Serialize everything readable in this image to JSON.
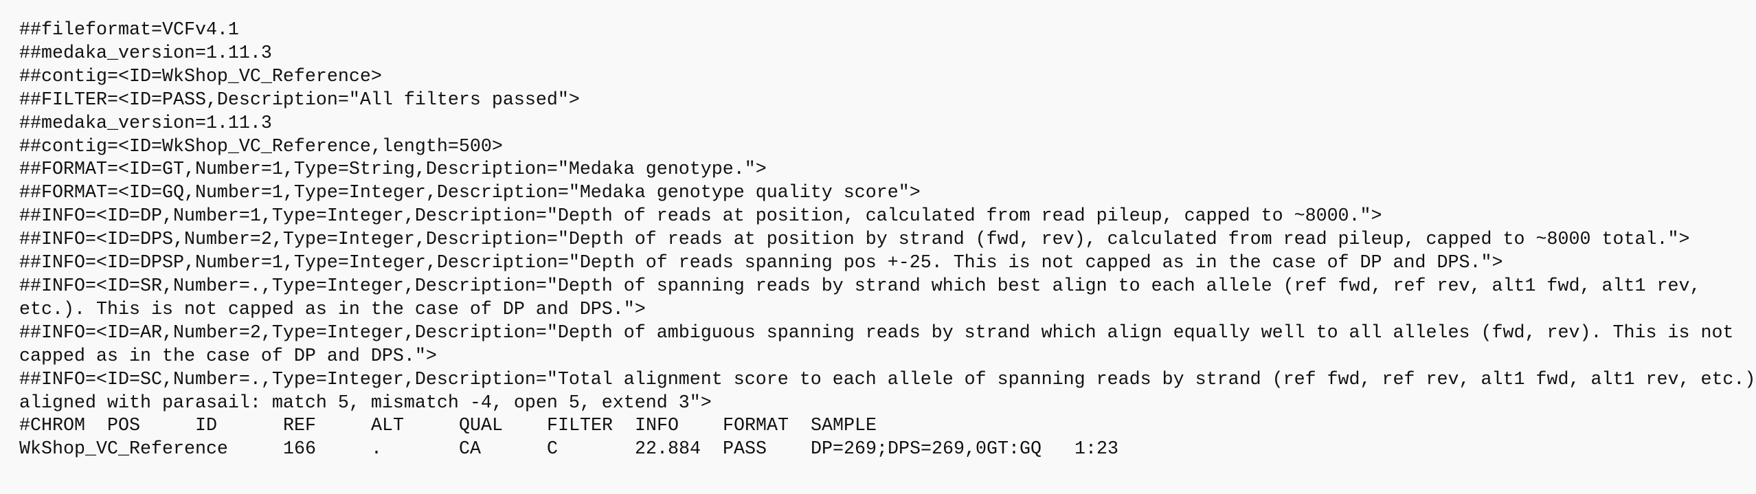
{
  "document": {
    "type": "VCF file contents",
    "meta_lines": [
      "##fileformat=VCFv4.1",
      "##medaka_version=1.11.3",
      "##contig=<ID=WkShop_VC_Reference>",
      "##FILTER=<ID=PASS,Description=\"All filters passed\">",
      "##medaka_version=1.11.3",
      "##contig=<ID=WkShop_VC_Reference,length=500>",
      "##FORMAT=<ID=GT,Number=1,Type=String,Description=\"Medaka genotype.\">",
      "##FORMAT=<ID=GQ,Number=1,Type=Integer,Description=\"Medaka genotype quality score\">",
      "##INFO=<ID=DP,Number=1,Type=Integer,Description=\"Depth of reads at position, calculated from read pileup, capped to ~8000.\">",
      "##INFO=<ID=DPS,Number=2,Type=Integer,Description=\"Depth of reads at position by strand (fwd, rev), calculated from read pileup, capped to ~8000 total.\">",
      "##INFO=<ID=DPSP,Number=1,Type=Integer,Description=\"Depth of reads spanning pos +-25. This is not capped as in the case of DP and DPS.\">",
      "##INFO=<ID=SR,Number=.,Type=Integer,Description=\"Depth of spanning reads by strand which best align to each allele (ref fwd, ref rev, alt1 fwd, alt1 rev, etc.). This is not capped as in the case of DP and DPS.\">",
      "##INFO=<ID=AR,Number=2,Type=Integer,Description=\"Depth of ambiguous spanning reads by strand which align equally well to all alleles (fwd, rev). This is not capped as in the case of DP and DPS.\">",
      "##INFO=<ID=SC,Number=.,Type=Integer,Description=\"Total alignment score to each allele of spanning reads by strand (ref fwd, ref rev, alt1 fwd, alt1 rev, etc.) aligned with parasail: match 5, mismatch -4, open 5, extend 3\">"
    ],
    "header_columns": [
      "#CHROM",
      "POS",
      "ID",
      "REF",
      "ALT",
      "QUAL",
      "FILTER",
      "INFO",
      "FORMAT",
      "SAMPLE"
    ],
    "records": [
      {
        "cells": [
          "WkShop_VC_Reference",
          "166",
          ".",
          "CA",
          "C",
          "22.884",
          "PASS",
          "DP=269;DPS=269,0",
          "GT:GQ",
          "1:23"
        ]
      }
    ]
  }
}
